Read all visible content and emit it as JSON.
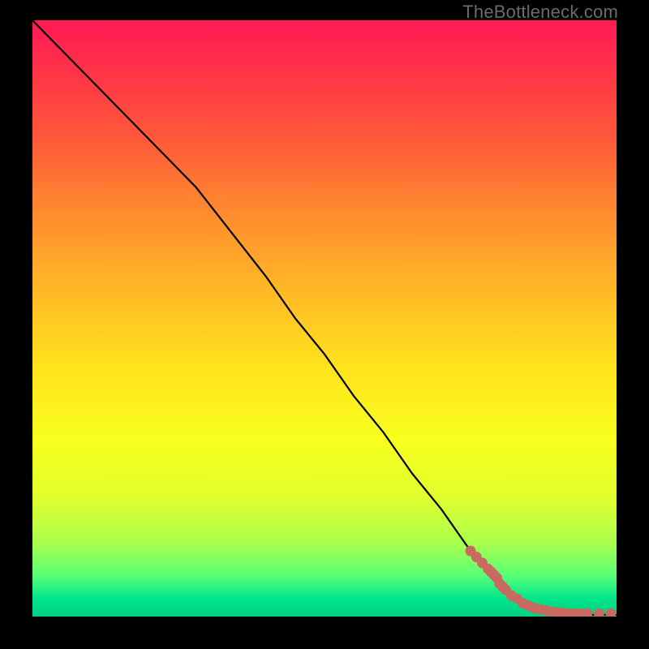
{
  "watermark": "TheBottleneck.com",
  "colors": {
    "dot": "#c86a60",
    "line": "#000000"
  },
  "chart_data": {
    "type": "line",
    "title": "",
    "xlabel": "",
    "ylabel": "",
    "xlim": [
      0,
      100
    ],
    "ylim": [
      0,
      100
    ],
    "grid": false,
    "legend": false,
    "background": "gradient-red-green",
    "series": [
      {
        "name": "curve",
        "x": [
          0,
          5,
          10,
          15,
          20,
          25,
          28,
          32,
          36,
          40,
          45,
          50,
          55,
          60,
          65,
          70,
          75,
          80,
          82,
          84,
          86,
          88,
          90,
          92,
          94,
          96,
          98,
          100
        ],
        "y": [
          100,
          95,
          90,
          85,
          80,
          75,
          72,
          67,
          62,
          57,
          50,
          44,
          37,
          31,
          24,
          18,
          11,
          5,
          3,
          2,
          1.2,
          0.8,
          0.5,
          0.4,
          0.3,
          0.3,
          0.3,
          0.3
        ]
      }
    ],
    "points": [
      {
        "name": "data-cluster",
        "style": "dot",
        "x": [
          75,
          76,
          77,
          78,
          78.5,
          79,
          79.5,
          80,
          80.5,
          81,
          82,
          83,
          84,
          85,
          86,
          87,
          88,
          89,
          90,
          91,
          92,
          93,
          94,
          95,
          97,
          99
        ],
        "y": [
          11,
          10,
          9,
          8,
          7.5,
          7,
          6.5,
          5.5,
          5,
          4.5,
          3.5,
          3,
          2.2,
          1.8,
          1.4,
          1.2,
          1.0,
          0.8,
          0.7,
          0.6,
          0.5,
          0.5,
          0.5,
          0.5,
          0.5,
          0.5
        ]
      }
    ]
  }
}
